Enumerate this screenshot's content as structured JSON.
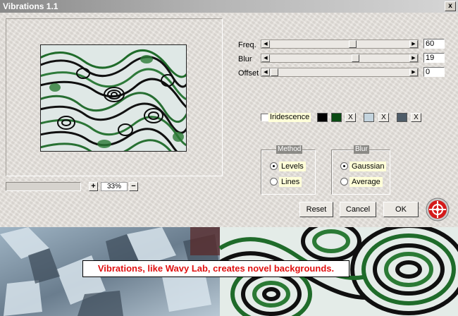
{
  "window": {
    "title": "Vibrations 1.1",
    "close_glyph": "x"
  },
  "preview": {
    "zoom_value": "33%",
    "zoom_in_label": "+",
    "zoom_out_label": "−"
  },
  "sliders": [
    {
      "label": "Freq.",
      "value": "60",
      "fraction": 0.6
    },
    {
      "label": "Blur",
      "value": "19",
      "fraction": 0.62
    },
    {
      "label": "Offset",
      "value": "0",
      "fraction": 0.0
    }
  ],
  "iridescence": {
    "label": "Iridescence",
    "checked": false,
    "colors": [
      "#000000",
      "#0a4a12",
      "#c4d4de",
      "#4e5c68"
    ],
    "clear_label": "X"
  },
  "method": {
    "title": "Method",
    "options": [
      {
        "label": "Levels",
        "selected": true
      },
      {
        "label": "Lines",
        "selected": false
      }
    ]
  },
  "blur": {
    "title": "Blur",
    "options": [
      {
        "label": "Gaussian",
        "selected": true
      },
      {
        "label": "Average",
        "selected": false
      }
    ]
  },
  "buttons": {
    "reset": "Reset",
    "cancel": "Cancel",
    "ok": "OK"
  },
  "caption": "Vibrations, like Wavy Lab, creates novel backgrounds."
}
